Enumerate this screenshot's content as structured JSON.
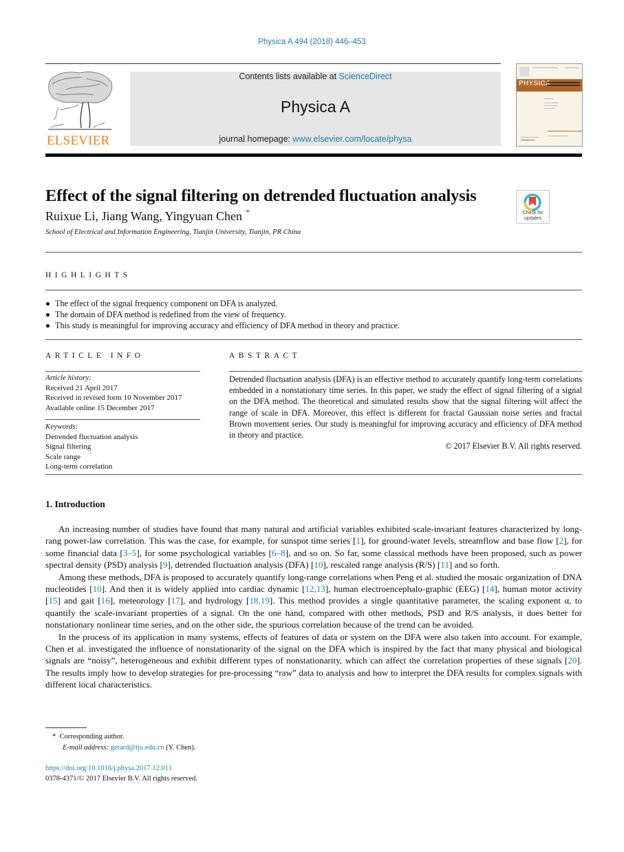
{
  "running_head": "Physica A 494 (2018) 446–453",
  "masthead": {
    "publisher_logo_text": "ELSEVIER",
    "contents_prefix": "Contents lists available at ",
    "contents_link": "ScienceDirect",
    "journal_name": "Physica A",
    "homepage_prefix": "journal homepage: ",
    "homepage_link": "www.elsevier.com/locate/physa",
    "cover_title": "PHYSICA",
    "brand_color": "#f07f21",
    "link_color": "#1f7fa8"
  },
  "article": {
    "title": "Effect of the signal filtering on detrended fluctuation analysis",
    "authors": "Ruixue Li, Jiang Wang, Yingyuan Chen",
    "corresponding_marker": "*",
    "affiliation": "School of Electrical and Information Engineering, Tianjin University, Tianjin, PR China",
    "crossmark_label_line1": "Check for",
    "crossmark_label_line2": "updates"
  },
  "highlights": {
    "heading": "HIGHLIGHTS",
    "items": [
      "The effect of the signal frequency component on DFA is analyzed.",
      "The domain of DFA method is redefined from the view of frequency.",
      "This study is meaningful for improving accuracy and efficiency of DFA method in theory and practice."
    ]
  },
  "article_info": {
    "heading": "ARTICLE INFO",
    "history_label": "Article history:",
    "history": [
      "Received 21 April 2017",
      "Received in revised form 10 November 2017",
      "Available online 15 December 2017"
    ],
    "keywords_label": "Keywords:",
    "keywords": [
      "Detrended fluctuation analysis",
      "Signal filtering",
      "Scale range",
      "Long-term correlation"
    ]
  },
  "abstract": {
    "heading": "ABSTRACT",
    "text": "Detrended fluctuation analysis (DFA) is an effective method to accurately quantify long-term correlations embedded in a nonstationary time series. In this paper, we study the effect of signal filtering of a signal on the DFA method. The theoretical and simulated results show that the signal filtering will affect the range of scale in DFA. Moreover, this effect is different for fractal Gaussian noise series and fractal Brown movement series. Our study is meaningful for improving accuracy and efficiency of DFA method in theory and practice.",
    "copyright": "© 2017 Elsevier B.V. All rights reserved."
  },
  "introduction": {
    "heading": "1.  Introduction",
    "p1": {
      "a": "An increasing number of studies have found that many natural and artificial variables exhibited scale-invariant features characterized by long-rang power-law correlation. This was the case, for example, for sunspot time series [",
      "c1": "1",
      "b": "], for ground-water levels, streamflow and base flow [",
      "c2": "2",
      "c": "], for some financial data [",
      "c3": "3–5",
      "d": "], for some psychological variables [",
      "c4": "6–8",
      "e": "], and so on. So far, some classical methods have been proposed, such as power spectral density (PSD) analysis [",
      "c5": "9",
      "f": "], detrended fluctuation analysis (DFA) [",
      "c6": "10",
      "g": "], rescaled range analysis (R/S) [",
      "c7": "11",
      "h": "] and so forth."
    },
    "p2": {
      "a": "Among these methods, DFA is proposed to accurately quantify long-range correlations when Peng et al. studied the mosaic organization of DNA nucleotides [",
      "c1": "10",
      "b": "]. And then it is widely applied into cardiac dynamic [",
      "c2": "12,13",
      "c": "], human electroencephalo-graphic (EEG) [",
      "c3": "14",
      "d": "], human motor activity [",
      "c4": "15",
      "e": "] and gait [",
      "c5": "16",
      "f": "], meteorology [",
      "c6": "17",
      "g": "], and hydrology [",
      "c7": "18,19",
      "h": "]. This method provides a single quantitative parameter, the scaling exponent α, to quantify the scale-invariant properties of a signal. On the one hand, compared with other methods, PSD and R/S analysis, it does better for nonstationary nonlinear time series, and on the other side, the spurious correlation because of the trend can be avoided."
    },
    "p3": {
      "a": "In the process of its application in many systems, effects of features of data or system on the DFA were also taken into account. For example, Chen et al. investigated the influence of nonstationarity of the signal on the DFA which is inspired by the fact that many physical and biological signals are “noisy”, heterogeneous and exhibit different types of nonstationarity, which can affect the correlation properties of these signals [",
      "c1": "20",
      "b": "]. The results imply how to develop strategies for pre-processing “raw” data to analysis and how to interpret the DFA results for complex signals with different local characteristics."
    }
  },
  "footnotes": {
    "marker": "*",
    "corresponding": "Corresponding author.",
    "email_label": "E-mail address:",
    "email": "gerard@tju.edu.cn",
    "email_suffix": " (Y. Chen).",
    "doi": "https://doi.org/10.1016/j.physa.2017.12.011",
    "issn": "0378-4371/© 2017 Elsevier B.V. All rights reserved."
  }
}
